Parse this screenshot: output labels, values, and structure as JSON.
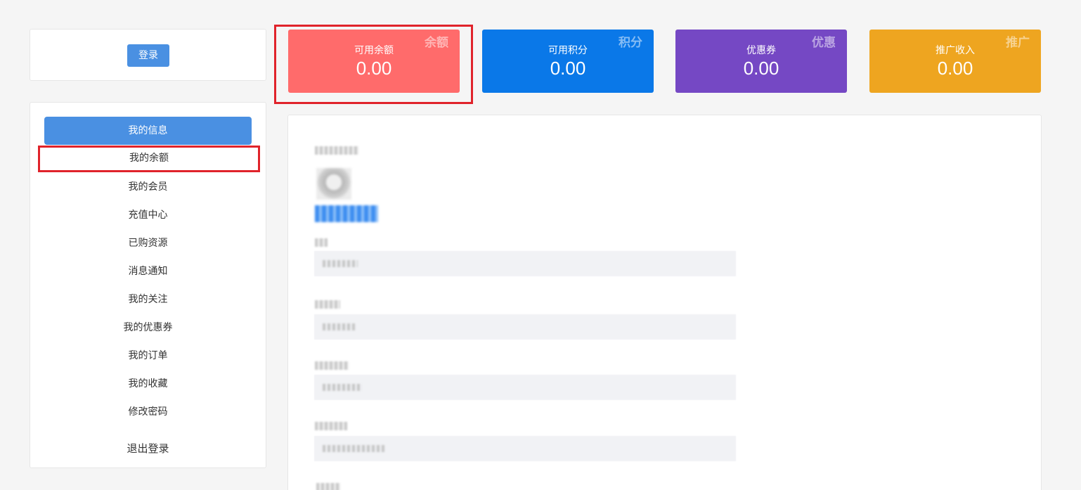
{
  "login": {
    "button_label": "登录"
  },
  "sidebar": {
    "items": [
      {
        "label": "我的信息"
      },
      {
        "label": "我的余额"
      },
      {
        "label": "我的会员"
      },
      {
        "label": "充值中心"
      },
      {
        "label": "已购资源"
      },
      {
        "label": "消息通知"
      },
      {
        "label": "我的关注"
      },
      {
        "label": "我的优惠券"
      },
      {
        "label": "我的订单"
      },
      {
        "label": "我的收藏"
      },
      {
        "label": "修改密码"
      }
    ],
    "logout_label": "退出登录"
  },
  "stats": {
    "balance": {
      "label": "可用余额",
      "value": "0.00",
      "corner": "余额",
      "color": "#ff6b6b"
    },
    "points": {
      "label": "可用积分",
      "value": "0.00",
      "corner": "积分",
      "color": "#0a78e8"
    },
    "coupons": {
      "label": "优惠券",
      "value": "0.00",
      "corner": "优惠",
      "color": "#7548c4"
    },
    "promo": {
      "label": "推广收入",
      "value": "0.00",
      "corner": "推广",
      "color": "#eea520"
    }
  },
  "colors": {
    "accent": "#4a90e2",
    "highlight": "#e0232b"
  }
}
